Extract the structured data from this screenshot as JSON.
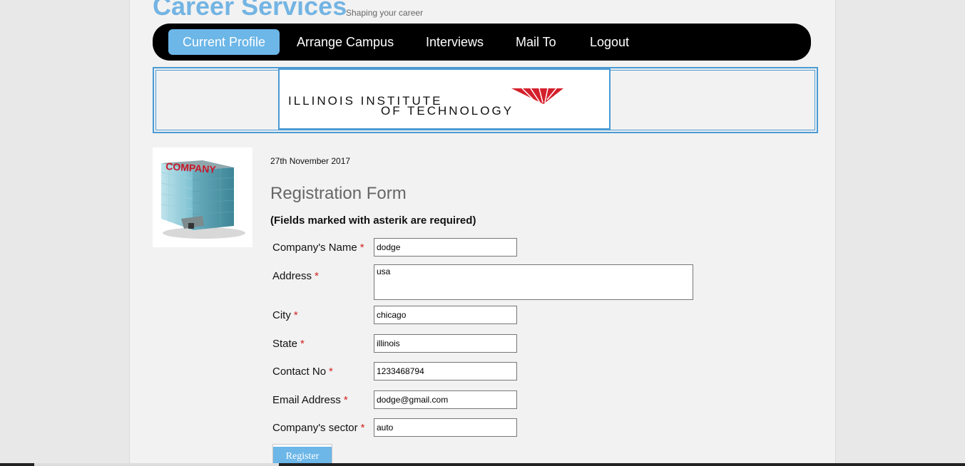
{
  "header": {
    "site_title": "Career Services",
    "tagline": "Shaping your career"
  },
  "nav": {
    "items": [
      {
        "label": "Current Profile",
        "active": true
      },
      {
        "label": "Arrange Campus",
        "active": false
      },
      {
        "label": "Interviews",
        "active": false
      },
      {
        "label": "Mail To",
        "active": false
      },
      {
        "label": "Logout",
        "active": false
      }
    ]
  },
  "banner": {
    "logo_line1": "ILLINOIS INSTITUTE",
    "logo_line2": "OF TECHNOLOGY",
    "logo_color": "#d4202c"
  },
  "sidebar_image": {
    "sign_text": "COMPANY"
  },
  "main": {
    "date": "27th November 2017",
    "form_title": "Registration Form",
    "required_note": "(Fields marked with asterik are required)",
    "asterisk": "*",
    "fields": [
      {
        "label": "Company's Name",
        "value": "dodge"
      },
      {
        "label": "Address",
        "value": "usa"
      },
      {
        "label": "City",
        "value": "chicago"
      },
      {
        "label": "State",
        "value": "illinois"
      },
      {
        "label": "Contact No",
        "value": "1233468794"
      },
      {
        "label": "Email Address",
        "value": "dodge@gmail.com"
      },
      {
        "label": "Company's sector",
        "value": "auto"
      }
    ],
    "register_label": "Register"
  },
  "colors": {
    "accent": "#6cb6e8",
    "title": "#73b4e3",
    "border": "#4a9ad4",
    "required": "#d32020"
  }
}
